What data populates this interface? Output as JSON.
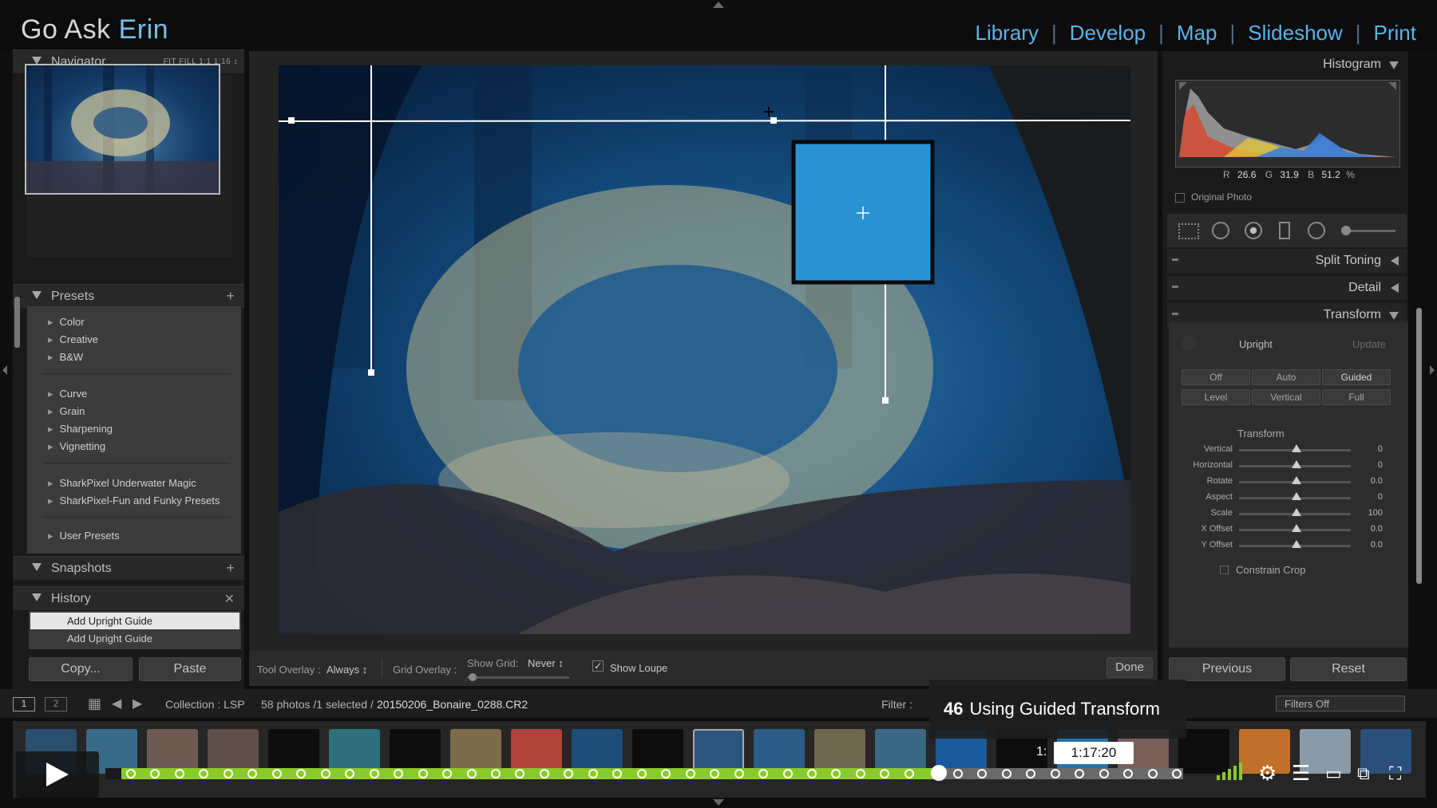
{
  "app": {
    "brand_plain": "Go Ask ",
    "brand_accent": "Erin"
  },
  "modules": [
    "Library",
    "Develop",
    "Map",
    "Slideshow",
    "Print"
  ],
  "navigator": {
    "title": "Navigator",
    "zoom_options": "FIT  FILL  1:1  1:16 ↕"
  },
  "presets": {
    "title": "Presets",
    "groups": [
      "Color",
      "Creative",
      "B&W",
      "Curve",
      "Grain",
      "Sharpening",
      "Vignetting",
      "SharkPixel Underwater Magic",
      "SharkPixel-Fun and Funky Presets",
      "User Presets"
    ]
  },
  "snapshots": {
    "title": "Snapshots"
  },
  "history": {
    "title": "History",
    "items": [
      "Add Upright Guide",
      "Add Upright Guide"
    ]
  },
  "left_buttons": {
    "copy": "Copy...",
    "paste": "Paste"
  },
  "toolbar": {
    "tool_overlay_label": "Tool Overlay :",
    "tool_overlay_value": "Always ↕",
    "grid_overlay_label": "Grid Overlay :",
    "show_grid_label": "Show Grid:",
    "show_grid_value": "Never ↕",
    "show_loupe_label": "Show Loupe",
    "done": "Done"
  },
  "histogram": {
    "title": "Histogram",
    "r_label": "R",
    "r_value": "26.6",
    "g_label": "G",
    "g_value": "31.9",
    "b_label": "B",
    "b_value": "51.2",
    "unit": "%",
    "original_photo": "Original Photo"
  },
  "right_panels": {
    "split_toning": "Split Toning",
    "detail": "Detail",
    "transform": "Transform"
  },
  "upright": {
    "label": "Upright",
    "update": "Update",
    "buttons_row1": [
      "Off",
      "Auto",
      "Guided"
    ],
    "buttons_row2": [
      "Level",
      "Vertical",
      "Full"
    ]
  },
  "transform": {
    "section": "Transform",
    "sliders": [
      {
        "name": "Vertical",
        "value": "0"
      },
      {
        "name": "Horizontal",
        "value": "0"
      },
      {
        "name": "Rotate",
        "value": "0.0"
      },
      {
        "name": "Aspect",
        "value": "0"
      },
      {
        "name": "Scale",
        "value": "100"
      },
      {
        "name": "X Offset",
        "value": "0.0"
      },
      {
        "name": "Y Offset",
        "value": "0.0"
      }
    ],
    "constrain_crop": "Constrain Crop"
  },
  "right_buttons": {
    "previous": "Previous",
    "reset": "Reset"
  },
  "filmstrip_bar": {
    "view1": "1",
    "view2": "2",
    "collection": "Collection : LSP",
    "count": "58 photos /1 selected /",
    "filename": "20150206_Bonaire_0288.CR2",
    "filter_label": "Filter :",
    "filters_off": "Filters Off"
  },
  "video": {
    "chapter_number": "46",
    "chapter_title": "Using Guided Transform",
    "time_prefix": "1:",
    "time": "1:17:20",
    "progress_fraction": 0.77
  },
  "colors": {
    "accent": "#78bfe9",
    "module_link": "#5ab4ea",
    "progress": "#8acb2a"
  }
}
